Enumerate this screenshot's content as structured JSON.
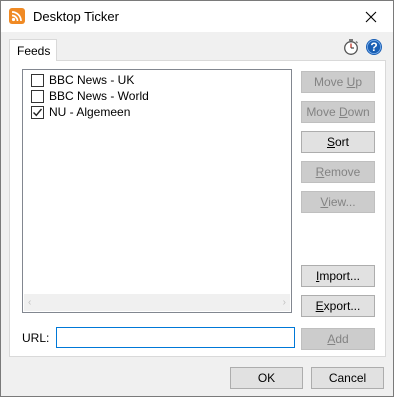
{
  "window": {
    "title": "Desktop Ticker",
    "close_glyph": "✕"
  },
  "tabs": [
    {
      "label": "Feeds",
      "selected": true
    }
  ],
  "feeds": [
    {
      "label": "BBC News - UK",
      "checked": false
    },
    {
      "label": "BBC News - World",
      "checked": false
    },
    {
      "label": "NU - Algemeen",
      "checked": true
    }
  ],
  "buttons": {
    "move_up": {
      "pre": "Move ",
      "u": "U",
      "post": "p",
      "enabled": false
    },
    "move_down": {
      "pre": "Move ",
      "u": "D",
      "post": "own",
      "enabled": false
    },
    "sort": {
      "pre": "",
      "u": "S",
      "post": "ort",
      "enabled": true
    },
    "remove": {
      "pre": "",
      "u": "R",
      "post": "emove",
      "enabled": false
    },
    "view": {
      "pre": "",
      "u": "V",
      "post": "iew...",
      "enabled": false
    },
    "import": {
      "pre": "",
      "u": "I",
      "post": "mport...",
      "enabled": true
    },
    "export": {
      "pre": "",
      "u": "E",
      "post": "xport...",
      "enabled": true
    },
    "add": {
      "pre": "",
      "u": "A",
      "post": "dd",
      "enabled": false
    }
  },
  "url": {
    "label": "URL:",
    "value": "",
    "placeholder": ""
  },
  "dialog_buttons": {
    "ok": "OK",
    "cancel": "Cancel"
  },
  "icons": {
    "app": "rss-icon",
    "timer": "stopwatch-icon",
    "help": "help-icon",
    "close": "close-icon"
  },
  "colors": {
    "rss_orange": "#f08a24",
    "help_blue": "#1a5fb4",
    "focus_border": "#0078d7"
  }
}
